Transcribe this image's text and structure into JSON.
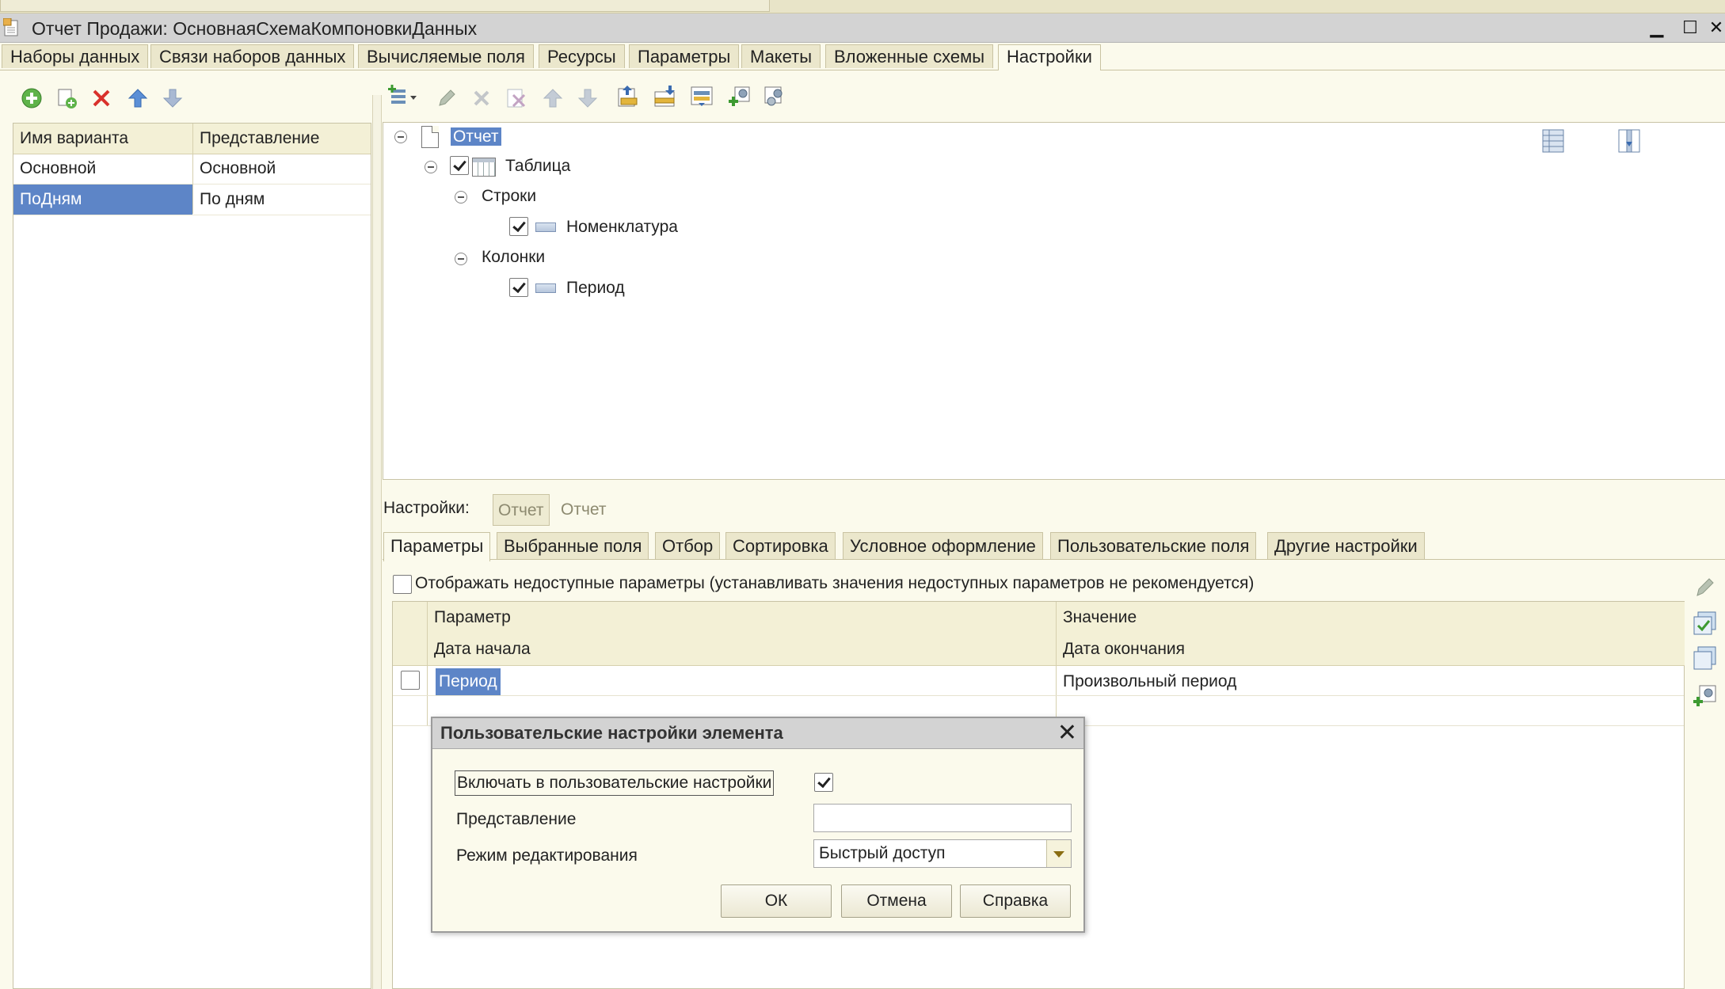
{
  "window": {
    "title": "Отчет Продажи: ОсновнаяСхемаКомпоновкиДанных",
    "minimize": "▁",
    "maximize": "☐",
    "close": "✕"
  },
  "main_tabs": [
    {
      "label": "Наборы данных"
    },
    {
      "label": "Связи наборов данных"
    },
    {
      "label": "Вычисляемые поля"
    },
    {
      "label": "Ресурсы"
    },
    {
      "label": "Параметры"
    },
    {
      "label": "Макеты"
    },
    {
      "label": "Вложенные схемы"
    },
    {
      "label": "Настройки",
      "active": true
    }
  ],
  "variants": {
    "columns": [
      "Имя варианта",
      "Представление"
    ],
    "rows": [
      {
        "name": "Основной",
        "view": "Основной"
      },
      {
        "name": "ПоДням",
        "view": "По дням",
        "selected": true
      }
    ]
  },
  "tree": {
    "root": "Отчет",
    "table": "Таблица",
    "rows_group": "Строки",
    "rows_field": "Номенклатура",
    "cols_group": "Колонки",
    "cols_field": "Период"
  },
  "settings": {
    "label": "Настройки:",
    "current_boxed": "Отчет",
    "current": "Отчет",
    "tabs": [
      "Параметры",
      "Выбранные поля",
      "Отбор",
      "Сортировка",
      "Условное оформление",
      "Пользовательские поля",
      "Другие настройки"
    ],
    "show_unavailable": "Отображать недоступные параметры (устанавливать значения недоступных параметров не рекомендуется)"
  },
  "params_table": {
    "head1": [
      "Параметр",
      "Значение"
    ],
    "head2": [
      "Дата начала",
      "Дата окончания"
    ],
    "row": {
      "param": "Период",
      "value": "Произвольный период"
    }
  },
  "dialog": {
    "title": "Пользовательские настройки элемента",
    "close": "✕",
    "include_label": "Включать в пользовательские настройки",
    "include_checked": true,
    "view_label": "Представление",
    "view_value": "",
    "mode_label": "Режим редактирования",
    "mode_value": "Быстрый доступ",
    "ok": "ОК",
    "cancel": "Отмена",
    "help": "Справка"
  },
  "colors": {
    "accent_selection": "#5d85c7",
    "background": "#fbfaec"
  }
}
